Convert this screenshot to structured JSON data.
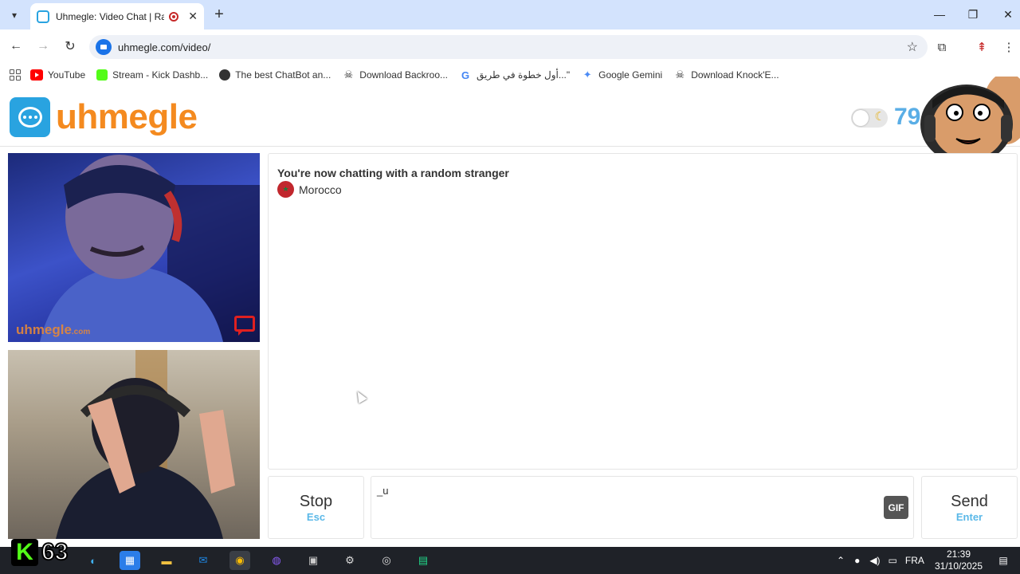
{
  "browser": {
    "tab_title": "Uhmegle: Video Chat | Random",
    "new_tab_label": "+",
    "url": "uhmegle.com/video/",
    "bookmarks": [
      {
        "label": "YouTube",
        "color": "#ff0000"
      },
      {
        "label": "Stream - Kick Dashb...",
        "color": "#53fc18"
      },
      {
        "label": "The best ChatBot an...",
        "color": "#333333"
      },
      {
        "label": "Download Backroo...",
        "color": "#333333"
      },
      {
        "label": "أول خطوة في طريق...\"",
        "color": "#4285f4"
      },
      {
        "label": "Google Gemini",
        "color": "#4c8bf5"
      },
      {
        "label": "Download Knock'E...",
        "color": "#333333"
      }
    ]
  },
  "site": {
    "logo_text": "uhmegle",
    "online_count": "79",
    "accent_color": "#f48a1f",
    "brand_blue": "#29a3e0"
  },
  "videos": {
    "remote_watermark": "uhmegle",
    "remote_watermark_suffix": ".com"
  },
  "chat": {
    "status": "You're now chatting with a random stranger",
    "country": "Morocco",
    "input_value": "_u",
    "gif_label": "GIF",
    "stop_label": "Stop",
    "stop_key": "Esc",
    "send_label": "Send",
    "send_key": "Enter"
  },
  "kick_overlay": {
    "logo": "K",
    "viewer_count": "63"
  },
  "taskbar": {
    "language": "FRA",
    "time": "21:39",
    "date": "31/10/2025"
  }
}
